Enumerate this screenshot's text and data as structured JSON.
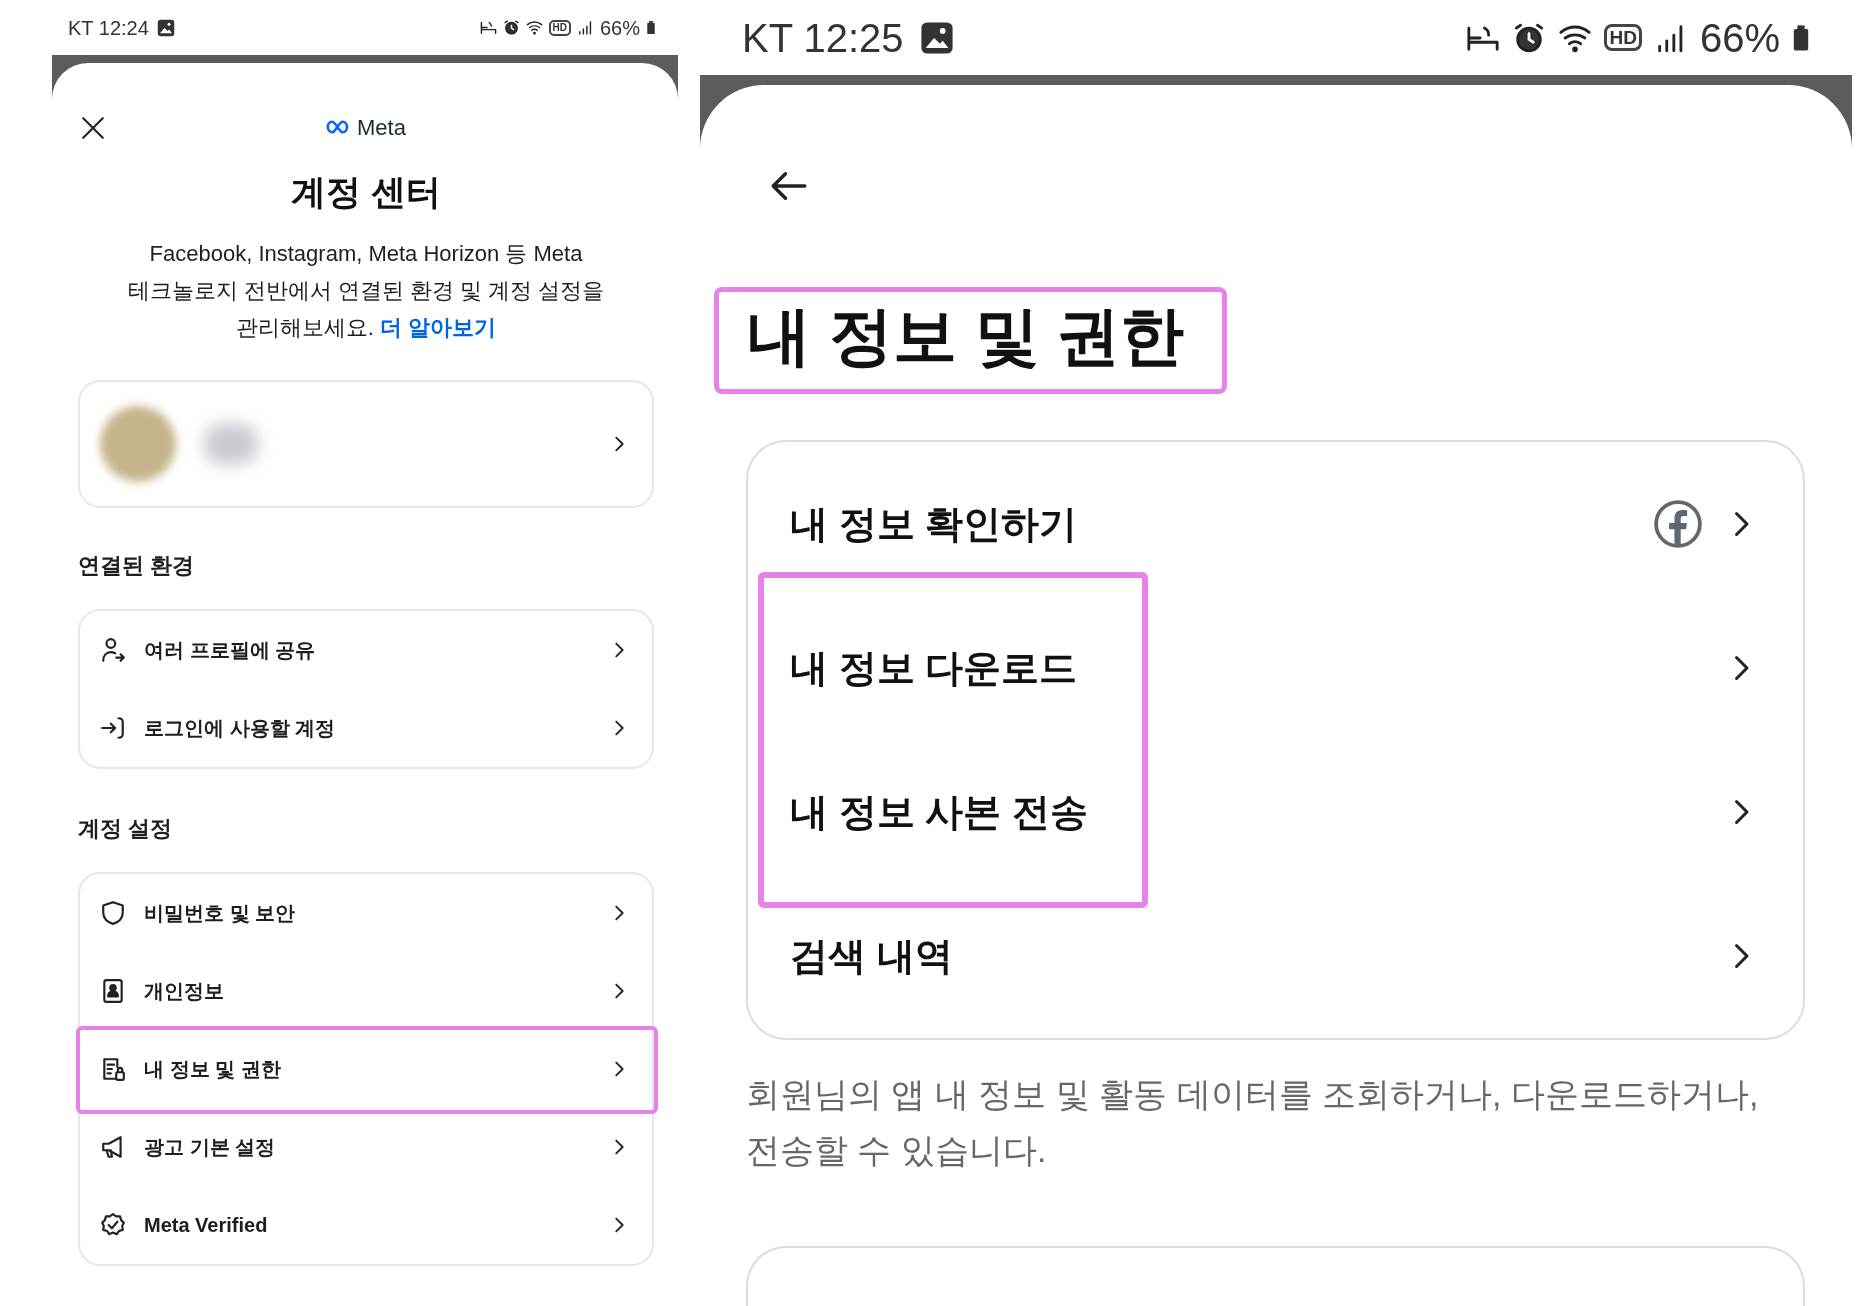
{
  "left_screen": {
    "status_bar": {
      "time": "KT 12:24",
      "hd": "HD",
      "battery": "66%"
    },
    "logo_text": "Meta",
    "title": "계정 센터",
    "description": "Facebook, Instagram, Meta Horizon 등 Meta 테크놀로지 전반에서 연결된 환경 및 계정 설정을 관리해보세요.",
    "learn_more_link": "더 알아보기",
    "profile_card": {
      "redacted": true
    },
    "sections": [
      {
        "heading": "연결된 환경",
        "items": [
          {
            "label": "여러 프로필에 공유",
            "kind": "share",
            "highlighted": false
          },
          {
            "label": "로그인에 사용할 계정",
            "kind": "login",
            "highlighted": false
          }
        ]
      },
      {
        "heading": "계정 설정",
        "items": [
          {
            "label": "비밀번호 및 보안",
            "kind": "security",
            "highlighted": false
          },
          {
            "label": "개인정보",
            "kind": "personal",
            "highlighted": false
          },
          {
            "label": "내 정보 및 권한",
            "kind": "info",
            "highlighted": true
          },
          {
            "label": "광고 기본 설정",
            "kind": "ads",
            "highlighted": false
          },
          {
            "label": "Meta Verified",
            "kind": "verified",
            "highlighted": false
          }
        ]
      }
    ]
  },
  "right_screen": {
    "status_bar": {
      "time": "KT 12:25",
      "hd": "HD",
      "battery": "66%"
    },
    "title": "내 정보 및 권한",
    "title_highlighted": true,
    "items": [
      {
        "label": "내 정보 확인하기",
        "kind": "linked",
        "highlighted": false
      },
      {
        "label": "내 정보 다운로드",
        "kind": "plain",
        "highlighted": true
      },
      {
        "label": "내 정보 사본 전송",
        "kind": "plain",
        "highlighted": true
      },
      {
        "label": "검색 내역",
        "kind": "plain",
        "highlighted": false
      }
    ],
    "description": "회원님의 앱 내 정보 및 활동 데이터를 조회하거나, 다운로드하거나, 전송할 수 있습니다."
  }
}
